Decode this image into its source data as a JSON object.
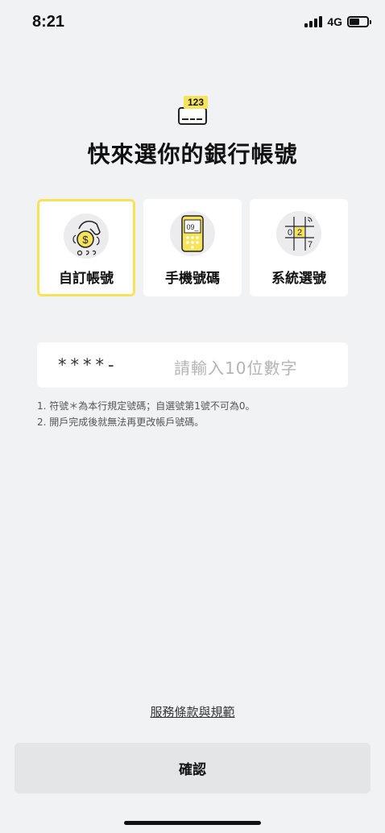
{
  "status_bar": {
    "time": "8:21",
    "network": "4G"
  },
  "header": {
    "badge_number": "123",
    "title": "快來選你的銀行帳號"
  },
  "options": [
    {
      "label": "自訂帳號",
      "selected": true,
      "icon": "hand-coin-icon"
    },
    {
      "label": "手機號碼",
      "selected": false,
      "icon": "phone-icon",
      "screen_text": "09_"
    },
    {
      "label": "系統選號",
      "selected": false,
      "icon": "grid-numbers-icon"
    }
  ],
  "grid_digits": [
    "0",
    "2",
    "7"
  ],
  "account_input": {
    "prefix": "****-",
    "placeholder": "請輸入10位數字"
  },
  "notes": [
    "1. 符號＊為本行規定號碼；自選號第1號不可為0。",
    "2. 開戶完成後就無法再更改帳戶號碼。"
  ],
  "terms_link": "服務條款與規範",
  "confirm_button": "確認",
  "colors": {
    "background": "#f1f2f4",
    "accent_yellow": "#f7e35a",
    "button_bg": "#e4e5e7"
  }
}
